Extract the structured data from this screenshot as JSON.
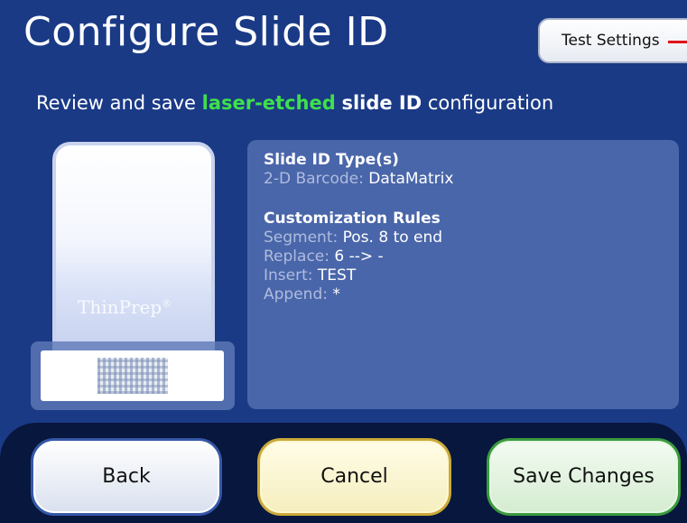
{
  "header": {
    "title": "Configure Slide ID",
    "test_settings_label": "Test Settings"
  },
  "subtitle": {
    "part1": "Review and save ",
    "highlight": "laser-etched",
    "part2": " ",
    "bold": "slide ID",
    "part3": " configuration"
  },
  "slide": {
    "brand": "ThinPrep",
    "brand_mark": "®"
  },
  "info": {
    "types_heading": "Slide ID Type(s)",
    "barcode_label": "2-D Barcode:",
    "barcode_value": "DataMatrix",
    "rules_heading": "Customization Rules",
    "rules": [
      {
        "label": "Segment:",
        "value": "Pos. 8 to end"
      },
      {
        "label": "Replace:",
        "value": "6 --> -"
      },
      {
        "label": "Insert:",
        "value": "TEST"
      },
      {
        "label": "Append:",
        "value": "*"
      }
    ]
  },
  "buttons": {
    "back": "Back",
    "cancel": "Cancel",
    "save": "Save Changes"
  },
  "colors": {
    "background": "#1a3a86",
    "highlight_green": "#3fe04a",
    "panel": "#4a66aa",
    "bottom_bar": "#07173d"
  }
}
